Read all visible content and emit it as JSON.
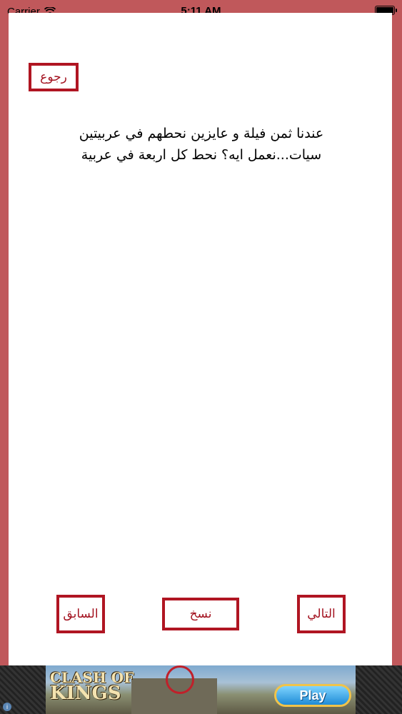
{
  "status_bar": {
    "carrier": "Carrier",
    "time": "5:11 AM",
    "battery_level": 1.0
  },
  "buttons": {
    "back": "رجوع",
    "previous": "السابق",
    "copy": "نسخ",
    "next": "التالي"
  },
  "riddle": {
    "line1": "عندنا ثمن فيلة و عايزين نحطهم في عربيتين",
    "line2": "سيات...نعمل ايه؟ نحط كل اربعة في عربية"
  },
  "ad": {
    "logo_line1": "CLASH OF",
    "logo_line2": "KINGS",
    "play_label": "Play",
    "info_icon": "i"
  },
  "colors": {
    "background": "#c0585b",
    "button_border": "#b01522",
    "button_text": "#a3121f"
  }
}
